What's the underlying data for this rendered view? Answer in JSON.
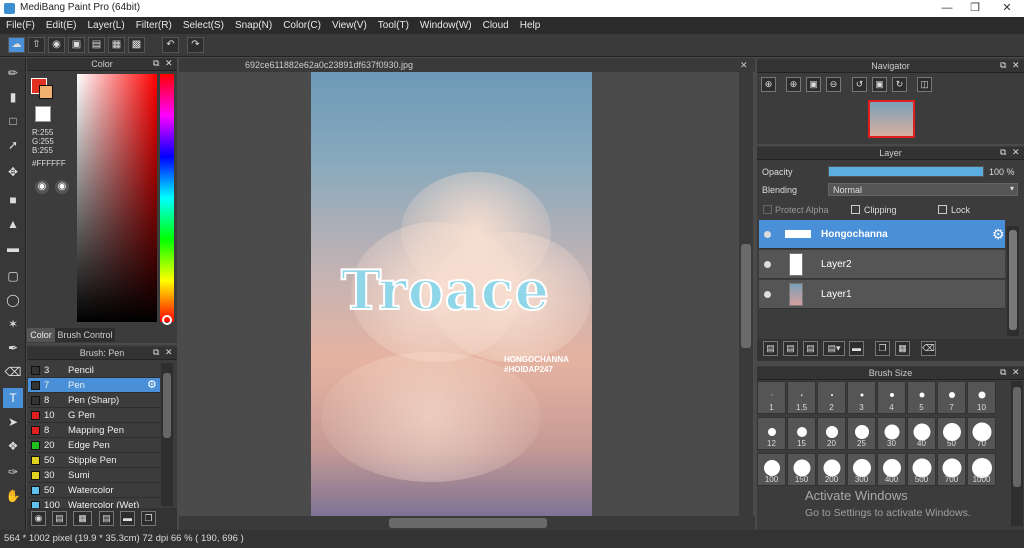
{
  "app": {
    "title": "MediBang Paint Pro (64bit)"
  },
  "menu": [
    "File(F)",
    "Edit(E)",
    "Layer(L)",
    "Filter(R)",
    "Select(S)",
    "Snap(N)",
    "Color(C)",
    "View(V)",
    "Tool(T)",
    "Window(W)",
    "Cloud",
    "Help"
  ],
  "color_panel": {
    "title": "Color",
    "r": "R:255",
    "g": "G:255",
    "b": "B:255",
    "hex": "#FFFFFF",
    "tab_color": "Color",
    "tab_brush_control": "Brush Control"
  },
  "brush_panel": {
    "title": "Brush: Pen",
    "items": [
      {
        "size": "3",
        "name": "Pencil",
        "color": "#333333"
      },
      {
        "size": "7",
        "name": "Pen",
        "color": "#333333"
      },
      {
        "size": "8",
        "name": "Pen (Sharp)",
        "color": "#333333"
      },
      {
        "size": "10",
        "name": "G Pen",
        "color": "#e02020"
      },
      {
        "size": "8",
        "name": "Mapping Pen",
        "color": "#e02020"
      },
      {
        "size": "20",
        "name": "Edge Pen",
        "color": "#20c020"
      },
      {
        "size": "50",
        "name": "Stipple Pen",
        "color": "#e0d020"
      },
      {
        "size": "30",
        "name": "Sumi",
        "color": "#e0d020"
      },
      {
        "size": "50",
        "name": "Watercolor",
        "color": "#60c0f0"
      },
      {
        "size": "100",
        "name": "Watercolor (Wet)",
        "color": "#60c0f0"
      }
    ]
  },
  "canvas": {
    "doc_title": "692ce611882e62a0c23891df637f0930.jpg",
    "art_title": "Troace",
    "art_sub1": "HONGOCHANNA",
    "art_sub2": "#HOIDAP247"
  },
  "navigator": {
    "title": "Navigator"
  },
  "layer_panel": {
    "title": "Layer",
    "opacity_label": "Opacity",
    "opacity_value": "100 %",
    "opacity": 1.0,
    "blending_label": "Blending",
    "blending_value": "Normal",
    "protect_alpha": "Protect Alpha",
    "clipping": "Clipping",
    "lock": "Lock",
    "layers": [
      {
        "name": "Hongochanna"
      },
      {
        "name": "Layer2"
      },
      {
        "name": "Layer1"
      }
    ]
  },
  "brush_size_panel": {
    "title": "Brush Size",
    "sizes": [
      "1",
      "1.5",
      "2",
      "3",
      "4",
      "5",
      "7",
      "10",
      "12",
      "15",
      "20",
      "25",
      "30",
      "40",
      "50",
      "70",
      "100",
      "150",
      "200",
      "300",
      "400",
      "500",
      "700",
      "1000"
    ]
  },
  "watermark": {
    "line1": "Activate Windows",
    "line2": "Go to Settings to activate Windows."
  },
  "status": {
    "text": "564 * 1002 pixel  (19.9 * 35.3cm)  72 dpi  66 %  ( 190, 696 )"
  }
}
